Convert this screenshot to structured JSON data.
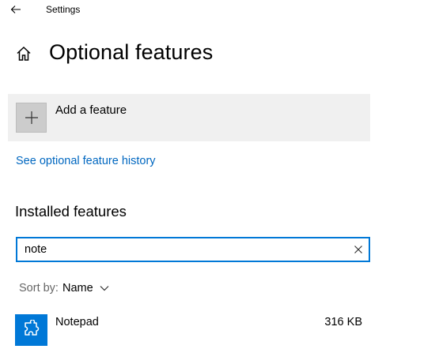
{
  "window": {
    "app_title": "Settings",
    "back_icon": "back-arrow-icon"
  },
  "header": {
    "home_icon": "home-icon",
    "title": "Optional features"
  },
  "add_feature": {
    "label": "Add a feature",
    "icon": "plus-icon"
  },
  "history_link": {
    "label": "See optional feature history",
    "color": "#0067c0"
  },
  "installed": {
    "heading": "Installed features",
    "search": {
      "value": "note",
      "clear_icon": "close-icon",
      "border_color": "#0078d7"
    },
    "sort": {
      "prefix": "Sort by:",
      "value": "Name",
      "icon": "chevron-down-icon"
    },
    "items": [
      {
        "name": "Notepad",
        "size": "316 KB",
        "icon": "puzzle-piece-icon",
        "icon_bg": "#0078d7"
      }
    ]
  }
}
